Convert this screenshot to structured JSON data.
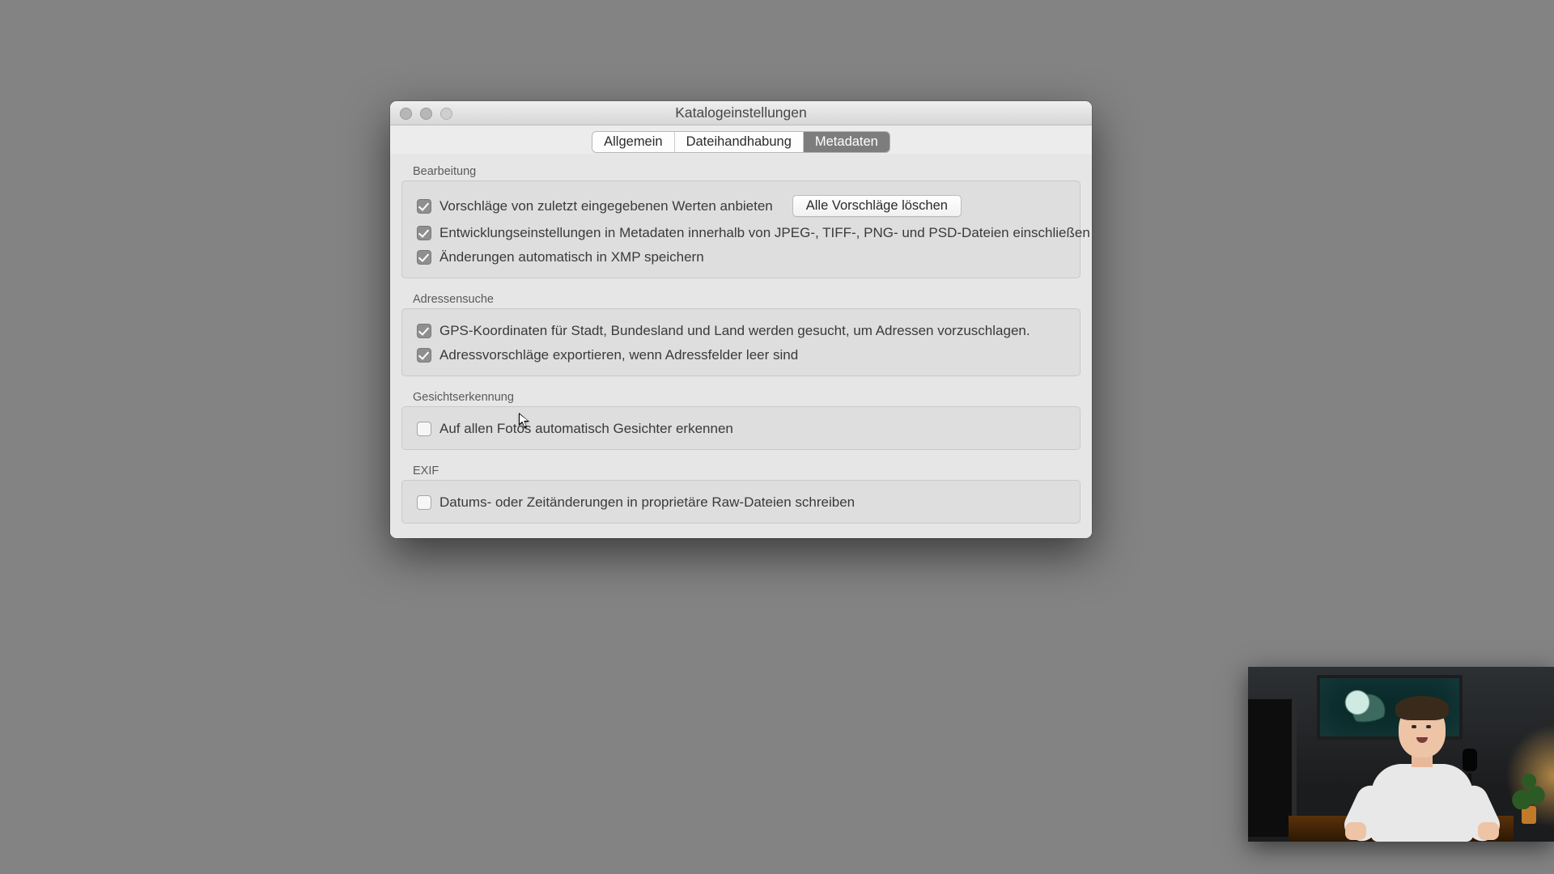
{
  "window": {
    "title": "Katalogeinstellungen"
  },
  "tabs": {
    "general": "Allgemein",
    "filehandling": "Dateihandhabung",
    "metadata": "Metadaten",
    "active": "metadata"
  },
  "sections": {
    "editing": {
      "title": "Bearbeitung",
      "suggest_recent": {
        "label": "Vorschläge von zuletzt eingegebenen Werten anbieten",
        "checked": true
      },
      "clear_button": "Alle Vorschläge löschen",
      "include_develop": {
        "label": "Entwicklungseinstellungen in Metadaten innerhalb von JPEG-, TIFF-, PNG- und PSD-Dateien einschließen",
        "checked": true
      },
      "auto_xmp": {
        "label": "Änderungen automatisch in XMP speichern",
        "checked": true
      }
    },
    "address": {
      "title": "Adressensuche",
      "gps_lookup": {
        "label": "GPS-Koordinaten für Stadt, Bundesland und Land werden gesucht, um Adressen vorzuschlagen.",
        "checked": true
      },
      "export_suggestions": {
        "label": "Adressvorschläge exportieren, wenn Adressfelder leer sind",
        "checked": true
      }
    },
    "face": {
      "title": "Gesichtserkennung",
      "auto_detect": {
        "label": "Auf allen Fotos automatisch Gesichter erkennen",
        "checked": false
      }
    },
    "exif": {
      "title": "EXIF",
      "write_date": {
        "label": "Datums- oder Zeitänderungen in proprietäre Raw-Dateien schreiben",
        "checked": false
      }
    }
  }
}
